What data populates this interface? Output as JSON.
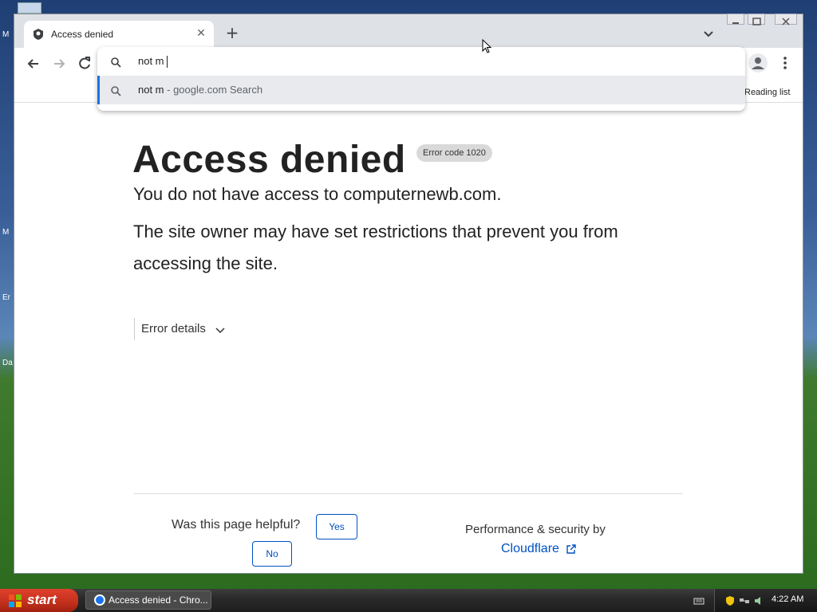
{
  "desktop": {
    "labels": [
      "M",
      "M",
      "Er",
      "Da"
    ]
  },
  "browser": {
    "tab": {
      "title": "Access denied",
      "close_glyph": "✕"
    },
    "new_tab_glyph": "+",
    "omnibox": {
      "input_value": "not m",
      "suggestion_primary": "not m",
      "suggestion_secondary": " - google.com Search"
    },
    "reading_list_label": "Reading list"
  },
  "page": {
    "title": "Access denied",
    "error_badge": "Error code 1020",
    "message_line1": "You do not have access to computernewb.com.",
    "message_line2": "The site owner may have set restrictions that prevent you from accessing the site.",
    "error_details_label": "Error details",
    "helpful_question": "Was this page helpful?",
    "yes_label": "Yes",
    "no_label": "No",
    "performance_text": "Performance & security by",
    "cloudflare_link": "Cloudflare"
  },
  "taskbar": {
    "start_label": "start",
    "task_label": "Access denied - Chro...",
    "clock": "4:22 AM"
  },
  "colors": {
    "link_blue": "#0051c3",
    "omnibox_accent": "#1a73e8",
    "start_red": "#c2301c"
  }
}
